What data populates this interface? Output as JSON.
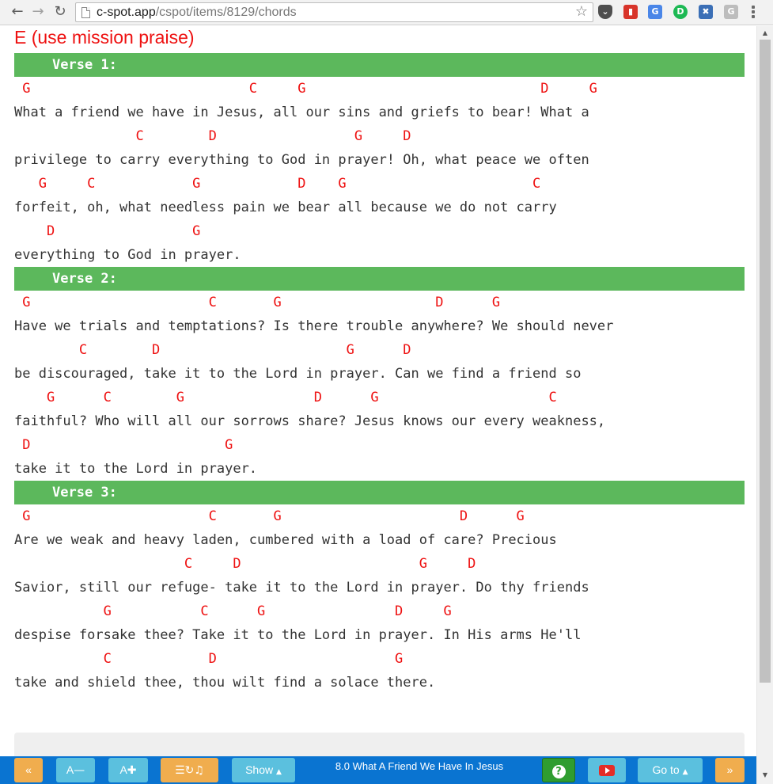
{
  "browser": {
    "url_host": "c-spot.app",
    "url_path": "/cspot/items/8129/chords"
  },
  "song": {
    "key_note": "E (use mission praise)",
    "verses": [
      {
        "label": "Verse 1:",
        "lines": [
          {
            "chords": " G                           C     G                             D     G",
            "lyrics": "What a friend we have in Jesus, all our sins and griefs to bear! What a"
          },
          {
            "chords": "               C        D                 G     D",
            "lyrics": "privilege to carry everything to God in prayer! Oh, what peace we often"
          },
          {
            "chords": "   G     C            G            D    G                       C",
            "lyrics": "forfeit, oh, what needless pain we bear all because we do not carry"
          },
          {
            "chords": "    D                 G",
            "lyrics": "everything to God in prayer."
          }
        ]
      },
      {
        "label": "Verse 2:",
        "lines": [
          {
            "chords": " G                      C       G                   D      G",
            "lyrics": "Have we trials and temptations? Is there trouble anywhere? We should never"
          },
          {
            "chords": "        C        D                       G      D",
            "lyrics": "be discouraged, take it to the Lord in prayer. Can we find a friend so"
          },
          {
            "chords": "    G      C        G                D      G                     C",
            "lyrics": "faithful? Who will all our sorrows share? Jesus knows our every weakness,"
          },
          {
            "chords": " D                        G",
            "lyrics": "take it to the Lord in prayer."
          }
        ]
      },
      {
        "label": "Verse 3:",
        "lines": [
          {
            "chords": " G                      C       G                      D      G",
            "lyrics": "Are we weak and heavy laden, cumbered with a load of care? Precious"
          },
          {
            "chords": "                     C     D                      G     D",
            "lyrics": "Savior, still our refuge- take it to the Lord in prayer. Do thy friends"
          },
          {
            "chords": "           G           C      G                D     G",
            "lyrics": "despise forsake thee? Take it to the Lord in prayer. In His arms He'll"
          },
          {
            "chords": "           C            D                      G",
            "lyrics": "take and shield thee, thou wilt find a solace there."
          }
        ]
      }
    ]
  },
  "toolbar": {
    "prev": "«",
    "font_smaller": "A",
    "font_larger": "A",
    "show_label": "Show",
    "title": "8.0 What A Friend We Have In Jesus",
    "goto_label": "Go to",
    "next": "»"
  }
}
